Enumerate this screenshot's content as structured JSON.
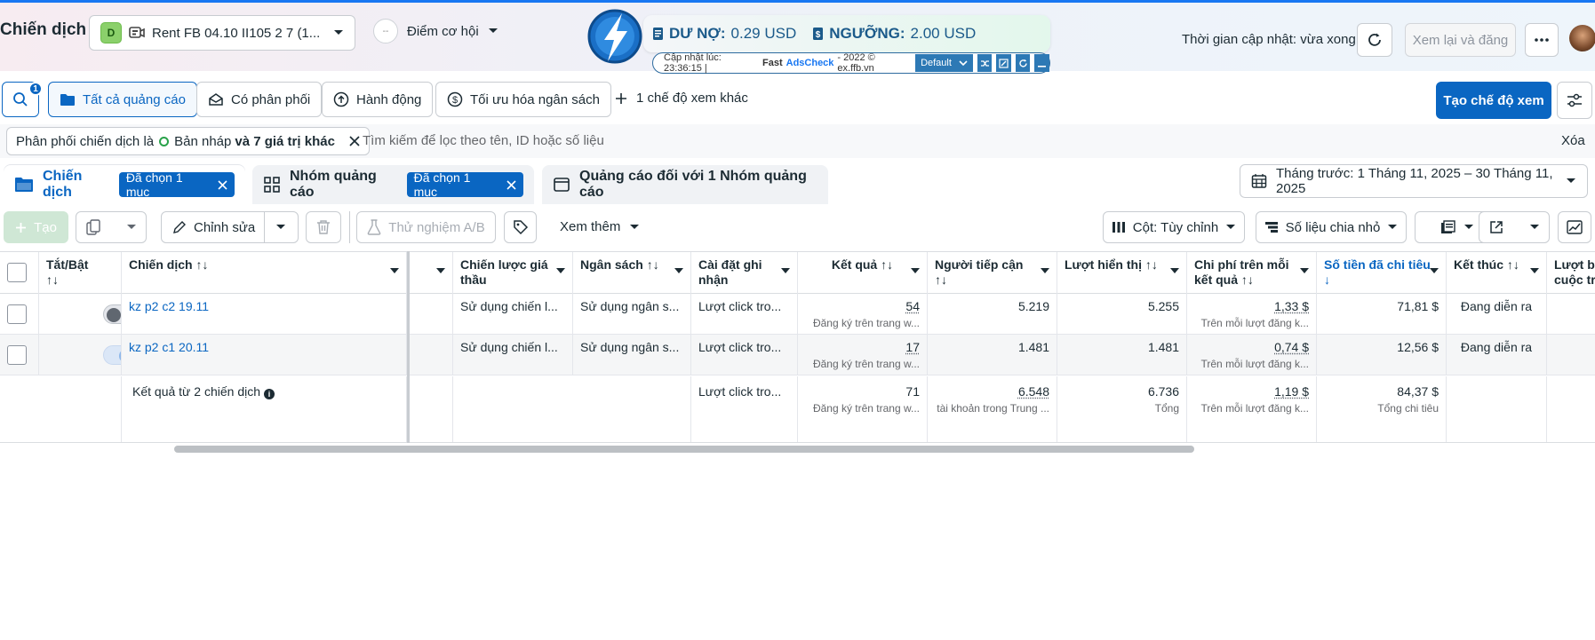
{
  "header": {
    "page_title": "Chiến dịch",
    "account": {
      "badge": "D",
      "name": "Rent FB 04.10 II105 2 7 (1..."
    },
    "opportunity": {
      "circle": "--",
      "label": "Điểm cơ hội"
    },
    "adscheck": {
      "debt_label": "DƯ NỢ:",
      "debt_value": "0.29 USD",
      "threshold_label": "NGƯỠNG:",
      "threshold_value": "2.00 USD",
      "update_prefix": "Cập nhật lúc: 23:36:15 |",
      "fast": "Fast",
      "ads": "AdsCheck",
      "suffix": "- 2022 © ex.ffb.vn",
      "mode": "Default"
    },
    "update_time": "Thời gian cập nhật: vừa xong",
    "review_button": "Xem lại và đăng"
  },
  "views": {
    "search_count": "1",
    "tabs": [
      "Tất cả quảng cáo",
      "Có phân phối",
      "Hành động",
      "Tối ưu hóa ngân sách"
    ],
    "more": "1 chế độ xem khác",
    "create_view": "Tạo chế độ xem"
  },
  "filter": {
    "chip_prefix": "Phân phối chiến dịch là",
    "chip_value": "Bản nháp",
    "chip_more": "và 7 giá trị khác",
    "placeholder": "Tìm kiếm để lọc theo tên, ID hoặc số liệu",
    "clear": "Xóa"
  },
  "levels": {
    "campaign": "Chiến dịch",
    "campaign_selected": "Đã chọn 1 mục",
    "adset": "Nhóm quảng cáo",
    "adset_selected": "Đã chọn 1 mục",
    "ads": "Quảng cáo đối với 1 Nhóm quảng cáo",
    "date_range": "Tháng trước: 1 Tháng 11, 2025 – 30 Tháng 11, 2025"
  },
  "actions": {
    "create": "Tạo",
    "edit": "Chỉnh sửa",
    "ab_test": "Thử nghiệm A/B",
    "see_more": "Xem thêm",
    "columns": "Cột: Tùy chỉnh",
    "breakdown": "Số liệu chia nhỏ"
  },
  "table": {
    "headers": {
      "toggle": "Tắt/Bật",
      "campaign": "Chiến dịch",
      "bid": "Chiến lược giá thầu",
      "budget": "Ngân sách",
      "attribution": "Cài đặt ghi nhận",
      "results": "Kết quả",
      "reach": "Người tiếp cận",
      "impressions": "Lượt hiển thị",
      "cpr": "Chi phí trên mỗi kết quả",
      "spent": "Số tiền đã chi tiêu",
      "end": "Kết thúc",
      "last": "Lượt b cuộc tr"
    },
    "sort_glyph": "↑↓",
    "rows": [
      {
        "name": "kz p2 c2 19.11",
        "active": false,
        "bid": "Sử dụng chiến l...",
        "budget": "Sử dụng ngân s...",
        "attribution": "Lượt click tro...",
        "results": "54",
        "results_sub": "Đăng ký trên trang w...",
        "reach": "5.219",
        "impressions": "5.255",
        "cpr": "1,33 $",
        "cpr_sub": "Trên mỗi lượt đăng k...",
        "spent": "71,81 $",
        "end": "Đang diễn ra"
      },
      {
        "name": "kz p2 c1 20.11",
        "active": true,
        "bid": "Sử dụng chiến l...",
        "budget": "Sử dụng ngân s...",
        "attribution": "Lượt click tro...",
        "results": "17",
        "results_sub": "Đăng ký trên trang w...",
        "reach": "1.481",
        "impressions": "1.481",
        "cpr": "0,74 $",
        "cpr_sub": "Trên mỗi lượt đăng k...",
        "spent": "12,56 $",
        "end": "Đang diễn ra"
      }
    ],
    "total": {
      "label": "Kết quả từ 2 chiến dịch",
      "attribution": "Lượt click tro...",
      "results": "71",
      "results_sub": "Đăng ký trên trang w...",
      "reach": "6.548",
      "reach_sub": "tài khoản trong Trung ...",
      "impressions": "6.736",
      "impressions_sub": "Tổng",
      "cpr": "1,19 $",
      "cpr_sub": "Trên mỗi lượt đăng k...",
      "spent": "84,37 $",
      "spent_sub": "Tổng chi tiêu"
    }
  }
}
